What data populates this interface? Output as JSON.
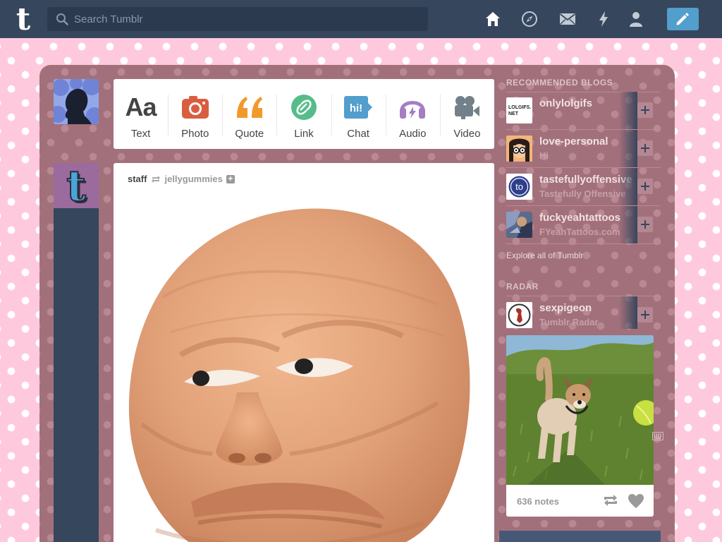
{
  "search": {
    "placeholder": "Search Tumblr"
  },
  "nav": [
    "home-icon",
    "compass-icon",
    "mail-icon",
    "lightning-icon",
    "person-icon"
  ],
  "colors": {
    "topbar": "#36465d",
    "accent": "#529ecc",
    "background": "#ffc9dd",
    "panel": "#a2707a"
  },
  "post_types": [
    {
      "label": "Text",
      "glyph": "Aa",
      "color": "#444444"
    },
    {
      "label": "Photo",
      "color": "#d95e40"
    },
    {
      "label": "Quote",
      "color": "#f2992e"
    },
    {
      "label": "Link",
      "color": "#56bc8a"
    },
    {
      "label": "Chat",
      "glyph": "hi!",
      "color": "#529ecc"
    },
    {
      "label": "Audio",
      "color": "#a77dc2"
    },
    {
      "label": "Video",
      "color": "#748089"
    }
  ],
  "post": {
    "author": "staff",
    "source": "jellygummies"
  },
  "sidebar": {
    "recommended_title": "RECOMMENDED BLOGS",
    "blogs": [
      {
        "name": "onlylolgifs",
        "subtitle": "",
        "avatar_text": "LOLGIFS. NET"
      },
      {
        "name": "love-personal",
        "subtitle": "Hi"
      },
      {
        "name": "tastefullyoffensive",
        "subtitle": "Tastefully Offensive",
        "avatar_text": "to"
      },
      {
        "name": "fuckyeahtattoos",
        "subtitle": "FYeahTattoos.com"
      }
    ],
    "explore": "Explore all of Tumblr",
    "radar_title": "RADAR",
    "radar": {
      "name": "sexpigeon",
      "subtitle": "Tumblr Radar",
      "notes": "636 notes"
    }
  }
}
